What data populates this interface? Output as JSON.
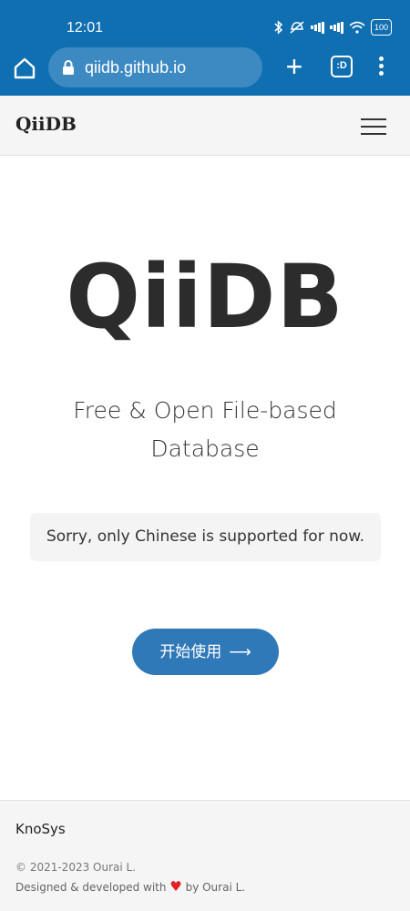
{
  "status_bar": {
    "time": "12:01",
    "battery": "100",
    "icons": [
      "bluetooth-icon",
      "mute-icon",
      "signal-icon",
      "signal-icon",
      "wifi-icon",
      "battery-icon"
    ]
  },
  "browser": {
    "url": "qiidb.github.io",
    "tab_count": ":D"
  },
  "site": {
    "brand": "QiiDB"
  },
  "hero": {
    "title": "QiiDB",
    "subtitle": "Free & Open File-based Database",
    "notice": "Sorry, only Chinese is supported for now.",
    "cta_label": "开始使用",
    "cta_arrow": "⟶"
  },
  "footer": {
    "org": "KnoSys",
    "copyright": "© 2021-2023 Ourai L.",
    "credit_prefix": "Designed & developed with",
    "credit_heart": "♥",
    "credit_suffix": "by Ourai L."
  },
  "colors": {
    "browser_chrome": "#0f6fb1",
    "cta": "#2f79b8"
  }
}
